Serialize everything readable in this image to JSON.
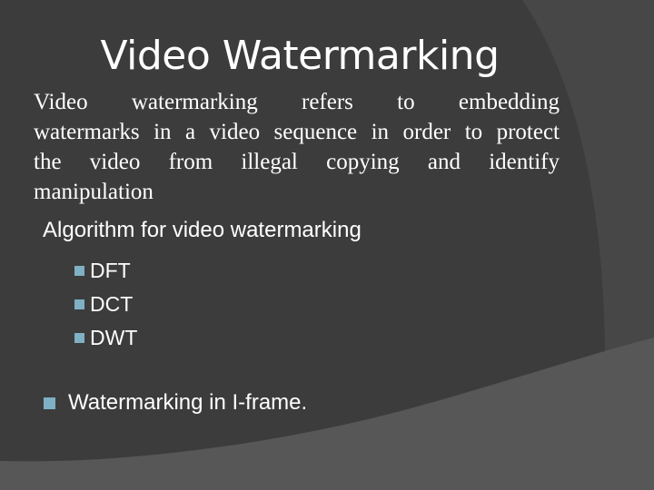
{
  "slide": {
    "title": "Video Watermarking",
    "paragraph_lines": [
      "Video watermarking refers to embedding",
      "watermarks in a video sequence in order to protect",
      "the video from illegal copying and identify",
      "manipulation"
    ],
    "subheading": "Algorithm for video watermarking",
    "algorithms": [
      "DFT",
      "DCT",
      "DWT"
    ],
    "bullet_point": "Watermarking in I-frame."
  },
  "colors": {
    "background": "#3c3c3c",
    "right_band": "#484848",
    "bottom_band": "#575757",
    "bullet": "#7fb0c4",
    "text": "#ffffff"
  }
}
